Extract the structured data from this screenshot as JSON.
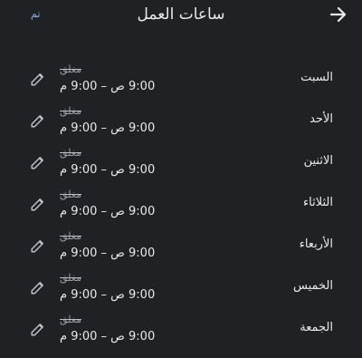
{
  "header": {
    "title": "ساعات العمل",
    "done_label": "تم",
    "back_icon": "arrow-right-icon"
  },
  "days": [
    {
      "day": "السبت",
      "closed_label": "مغلق",
      "hours": "9:00 ص – 9:00 م"
    },
    {
      "day": "الأحد",
      "closed_label": "مغلق",
      "hours": "9:00 ص – 9:00 م"
    },
    {
      "day": "الاثنين",
      "closed_label": "مغلق",
      "hours": "9:00 ص – 9:00 م"
    },
    {
      "day": "الثلاثاء",
      "closed_label": "مغلق",
      "hours": "9:00 ص – 9:00 م"
    },
    {
      "day": "الأربعاء",
      "closed_label": "مغلق",
      "hours": "9:00 ص – 9:00 م"
    },
    {
      "day": "الخميس",
      "closed_label": "مغلق",
      "hours": "9:00 ص – 9:00 م"
    },
    {
      "day": "الجمعة",
      "closed_label": "مغلق",
      "hours": "9:00 ص – 9:00 م"
    }
  ],
  "colors": {
    "background": "#202124",
    "text": "#e8eaed",
    "muted": "#9aa0a6",
    "accent": "#8ab4f8"
  }
}
